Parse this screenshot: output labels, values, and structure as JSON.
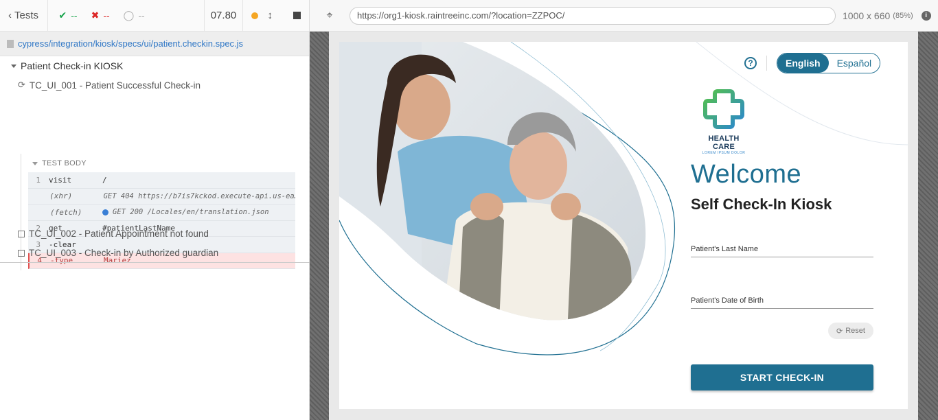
{
  "header": {
    "back_label": "Tests",
    "passed": "--",
    "failed": "--",
    "pending": "--",
    "duration": "07.80"
  },
  "spec": {
    "path": "cypress/integration/kiosk/specs/ui/patient.checkin.spec.js"
  },
  "suite": {
    "title": "Patient Check-in KIOSK",
    "tests": [
      {
        "title": "TC_UI_001 - Patient Successful Check-in"
      },
      {
        "title": "TC_UI_002 - Patient Appointment not found"
      },
      {
        "title": "TC_UI_003 - Check-in by Authorized guardian"
      }
    ],
    "test_body_label": "TEST BODY",
    "commands": [
      {
        "num": "1",
        "name": "visit",
        "msg": "/"
      },
      {
        "num": "",
        "name": "(xhr)",
        "msg": "GET 404 https://b7is7kckod.execute-api.us-ea…",
        "dot": "#f5a623"
      },
      {
        "num": "",
        "name": "(fetch)",
        "msg": "GET 200 /Locales/en/translation.json",
        "dot": "#3a7fd5"
      },
      {
        "num": "2",
        "name": "get",
        "msg": "#patientLastName"
      },
      {
        "num": "3",
        "name": "-clear",
        "msg": ""
      },
      {
        "num": "4",
        "name": "-type",
        "msg": "Mariez"
      }
    ]
  },
  "aut": {
    "url": "https://org1-kiosk.raintreeinc.com/?location=ZZPOC/",
    "viewport": "1000 x 660",
    "scale": "(85%)"
  },
  "kiosk": {
    "lang_english": "English",
    "lang_spanish": "Español",
    "brand": "HEALTH CARE",
    "tagline": "LOREM IPSUM DOLOR",
    "welcome": "Welcome",
    "subtitle": "Self Check-In Kiosk",
    "last_name_label": "Patient's Last Name",
    "dob_label": "Patient's Date of Birth",
    "reset_label": "Reset",
    "start_label": "START CHECK-IN"
  },
  "colors": {
    "primary": "#1f6f91",
    "pass": "#16a34a",
    "fail": "#dc2626",
    "link": "#3178c6",
    "active_row": "#fde2e2"
  }
}
